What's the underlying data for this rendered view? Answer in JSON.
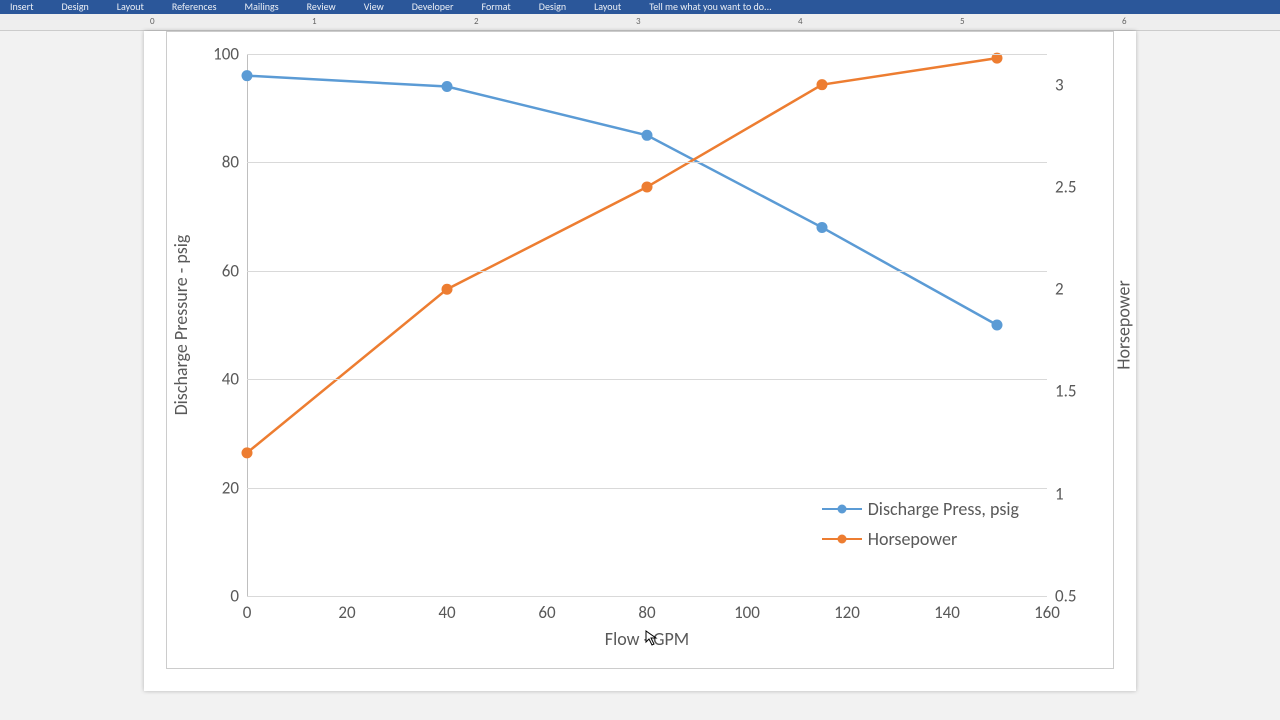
{
  "ribbon": {
    "tabs": [
      "Insert",
      "Design",
      "Layout",
      "References",
      "Mailings",
      "Review",
      "View",
      "Developer",
      "Format",
      "Design",
      "Layout",
      "Tell me what you want to do..."
    ]
  },
  "chart_data": {
    "type": "line",
    "x": [
      0,
      40,
      80,
      115,
      150
    ],
    "series": [
      {
        "name": "Discharge Press, psig",
        "values": [
          96,
          94,
          85,
          68,
          50
        ],
        "axis": "y1",
        "color": "#5b9bd5"
      },
      {
        "name": "Horsepower",
        "values": [
          1.2,
          2.0,
          2.5,
          3.0,
          3.13
        ],
        "axis": "y2",
        "color": "#ed7d31"
      }
    ],
    "xlabel": "Flow - GPM",
    "y1label": "Discharge Pressure - psig",
    "y2label": "Horsepower",
    "xticks": [
      0,
      20,
      40,
      60,
      80,
      100,
      120,
      140,
      160
    ],
    "y1ticks": [
      0,
      20,
      40,
      60,
      80,
      100
    ],
    "y2ticks": [
      0.5,
      1,
      1.5,
      2,
      2.5,
      3
    ],
    "xlim": [
      0,
      160
    ],
    "y1lim": [
      0,
      100
    ],
    "y2lim": [
      0.5,
      3.15
    ],
    "legend_position": "inside-bottom-right"
  },
  "legend": [
    {
      "label": "Discharge Press, psig",
      "color": "#5b9bd5"
    },
    {
      "label": "Horsepower",
      "color": "#ed7d31"
    }
  ]
}
